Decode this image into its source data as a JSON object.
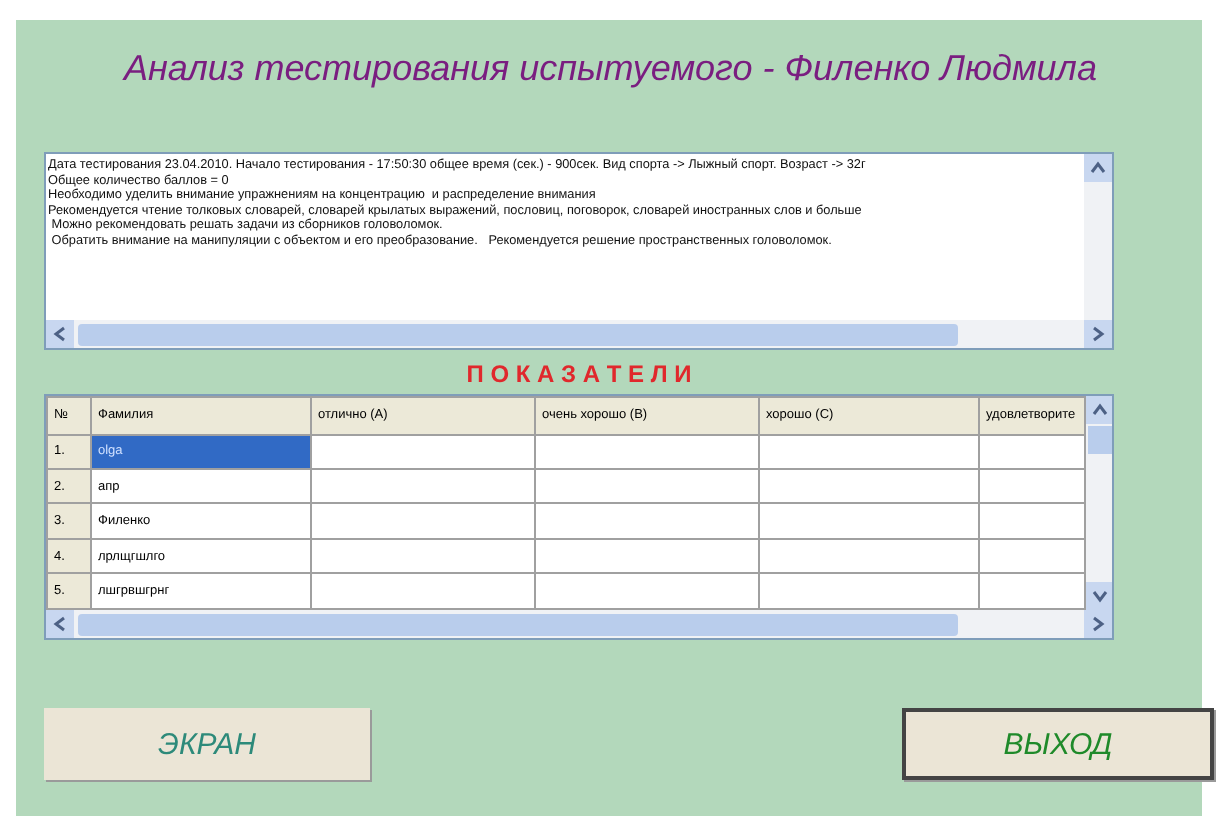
{
  "title": "Анализ тестирования испытуемого - Филенко Людмила",
  "report": {
    "lines": [
      "Дата тестирования 23.04.2010. Начало тестирования - 17:50:30 общее время (сек.) - 900сек. Вид спорта -> Лыжный спорт. Возраст -> 32г",
      "Общее количество баллов = 0",
      "Необходимо уделить внимание упражнениям на концентрацию  и распределение внимания",
      "Рекомендуется чтение толковых словарей, словарей крылатых выражений, пословиц, поговорок, словарей иностранных слов и больше",
      " Можно рекомендовать решать задачи из сборников головоломок.",
      " Обратить внимание на манипуляции с объектом и его преобразование.   Рекомендуется решение пространственных головоломок."
    ]
  },
  "section_title": "П О К А З А Т Е Л И",
  "table": {
    "columns": [
      "№",
      "Фамилия",
      "отлично  (A)",
      "очень хорошо (B)",
      "хорошо  (C)",
      "удовлетворите"
    ],
    "rows": [
      {
        "cells": [
          "1.",
          "olga",
          "",
          "",
          "",
          ""
        ],
        "selected": true
      },
      {
        "cells": [
          "2.",
          "апр",
          "",
          "",
          "",
          ""
        ],
        "selected": false
      },
      {
        "cells": [
          "3.",
          "Филенко",
          "",
          "",
          "",
          ""
        ],
        "selected": false
      },
      {
        "cells": [
          "4.",
          "лрлщгшлго",
          "",
          "",
          "",
          ""
        ],
        "selected": false
      },
      {
        "cells": [
          "5.",
          "лшгрвшгрнг",
          "",
          "",
          "",
          ""
        ],
        "selected": false
      }
    ]
  },
  "buttons": [
    {
      "label": "ЭКРАН",
      "kind": "plain"
    },
    {
      "label": "ВЫХОД",
      "kind": "framed"
    }
  ]
}
